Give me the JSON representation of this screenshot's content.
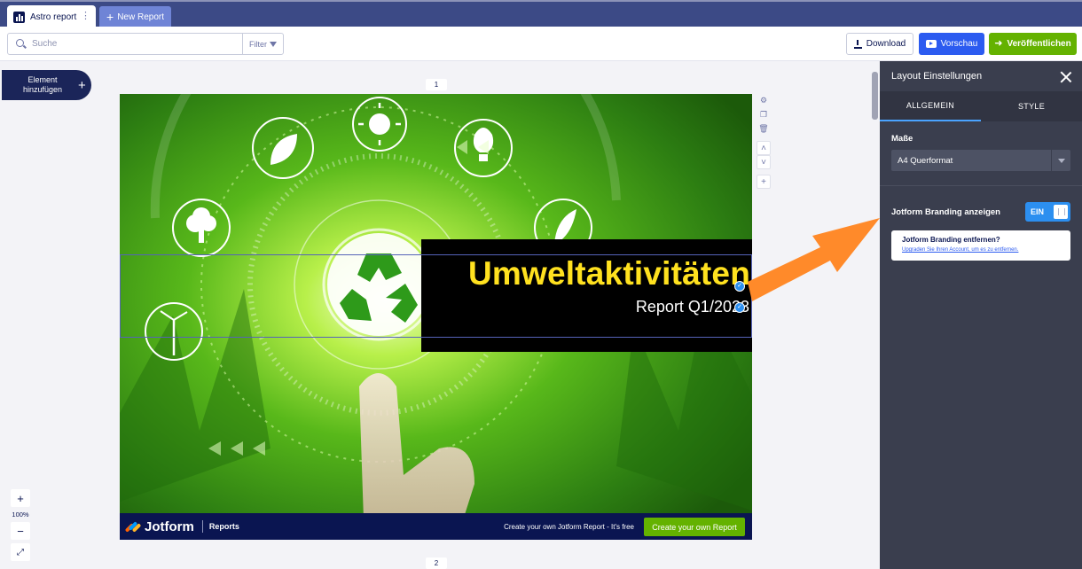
{
  "tabs": {
    "active_label": "Astro report",
    "new_label": "New Report"
  },
  "toolbar": {
    "search_placeholder": "Suche",
    "filter_label": "Filter",
    "download_label": "Download",
    "preview_label": "Vorschau",
    "publish_label": "Veröffentlichen"
  },
  "canvas": {
    "add_element_label": "Element hinzufügen",
    "page_numbers": [
      "1",
      "2"
    ],
    "zoom_level": "100%"
  },
  "page": {
    "title": "Umweltaktivitäten",
    "subtitle": "Report Q1/2023",
    "brand_name": "Jotform",
    "brand_product": "Reports",
    "cta_text": "Create your own Jotform Report - It's free",
    "cta_button": "Create your own Report"
  },
  "panel": {
    "title": "Layout Einstellungen",
    "tabs": [
      "ALLGEMEIN",
      "STYLE"
    ],
    "size_label": "Maße",
    "size_value": "A4 Querformat",
    "branding_label": "Jotform Branding anzeigen",
    "branding_toggle": "EIN",
    "branding_on": true,
    "upsell_title": "Jotform Branding entfernen?",
    "upsell_link": "Upgraden Sie Ihren Account, um es zu entfernen."
  },
  "colors": {
    "navy": "#0a1551",
    "accent_blue": "#2c5bf0",
    "green": "#64b200",
    "title_yellow": "#ffe11f",
    "toggle_blue": "#2c8ff0",
    "annotation_orange": "#ff8a2a"
  }
}
